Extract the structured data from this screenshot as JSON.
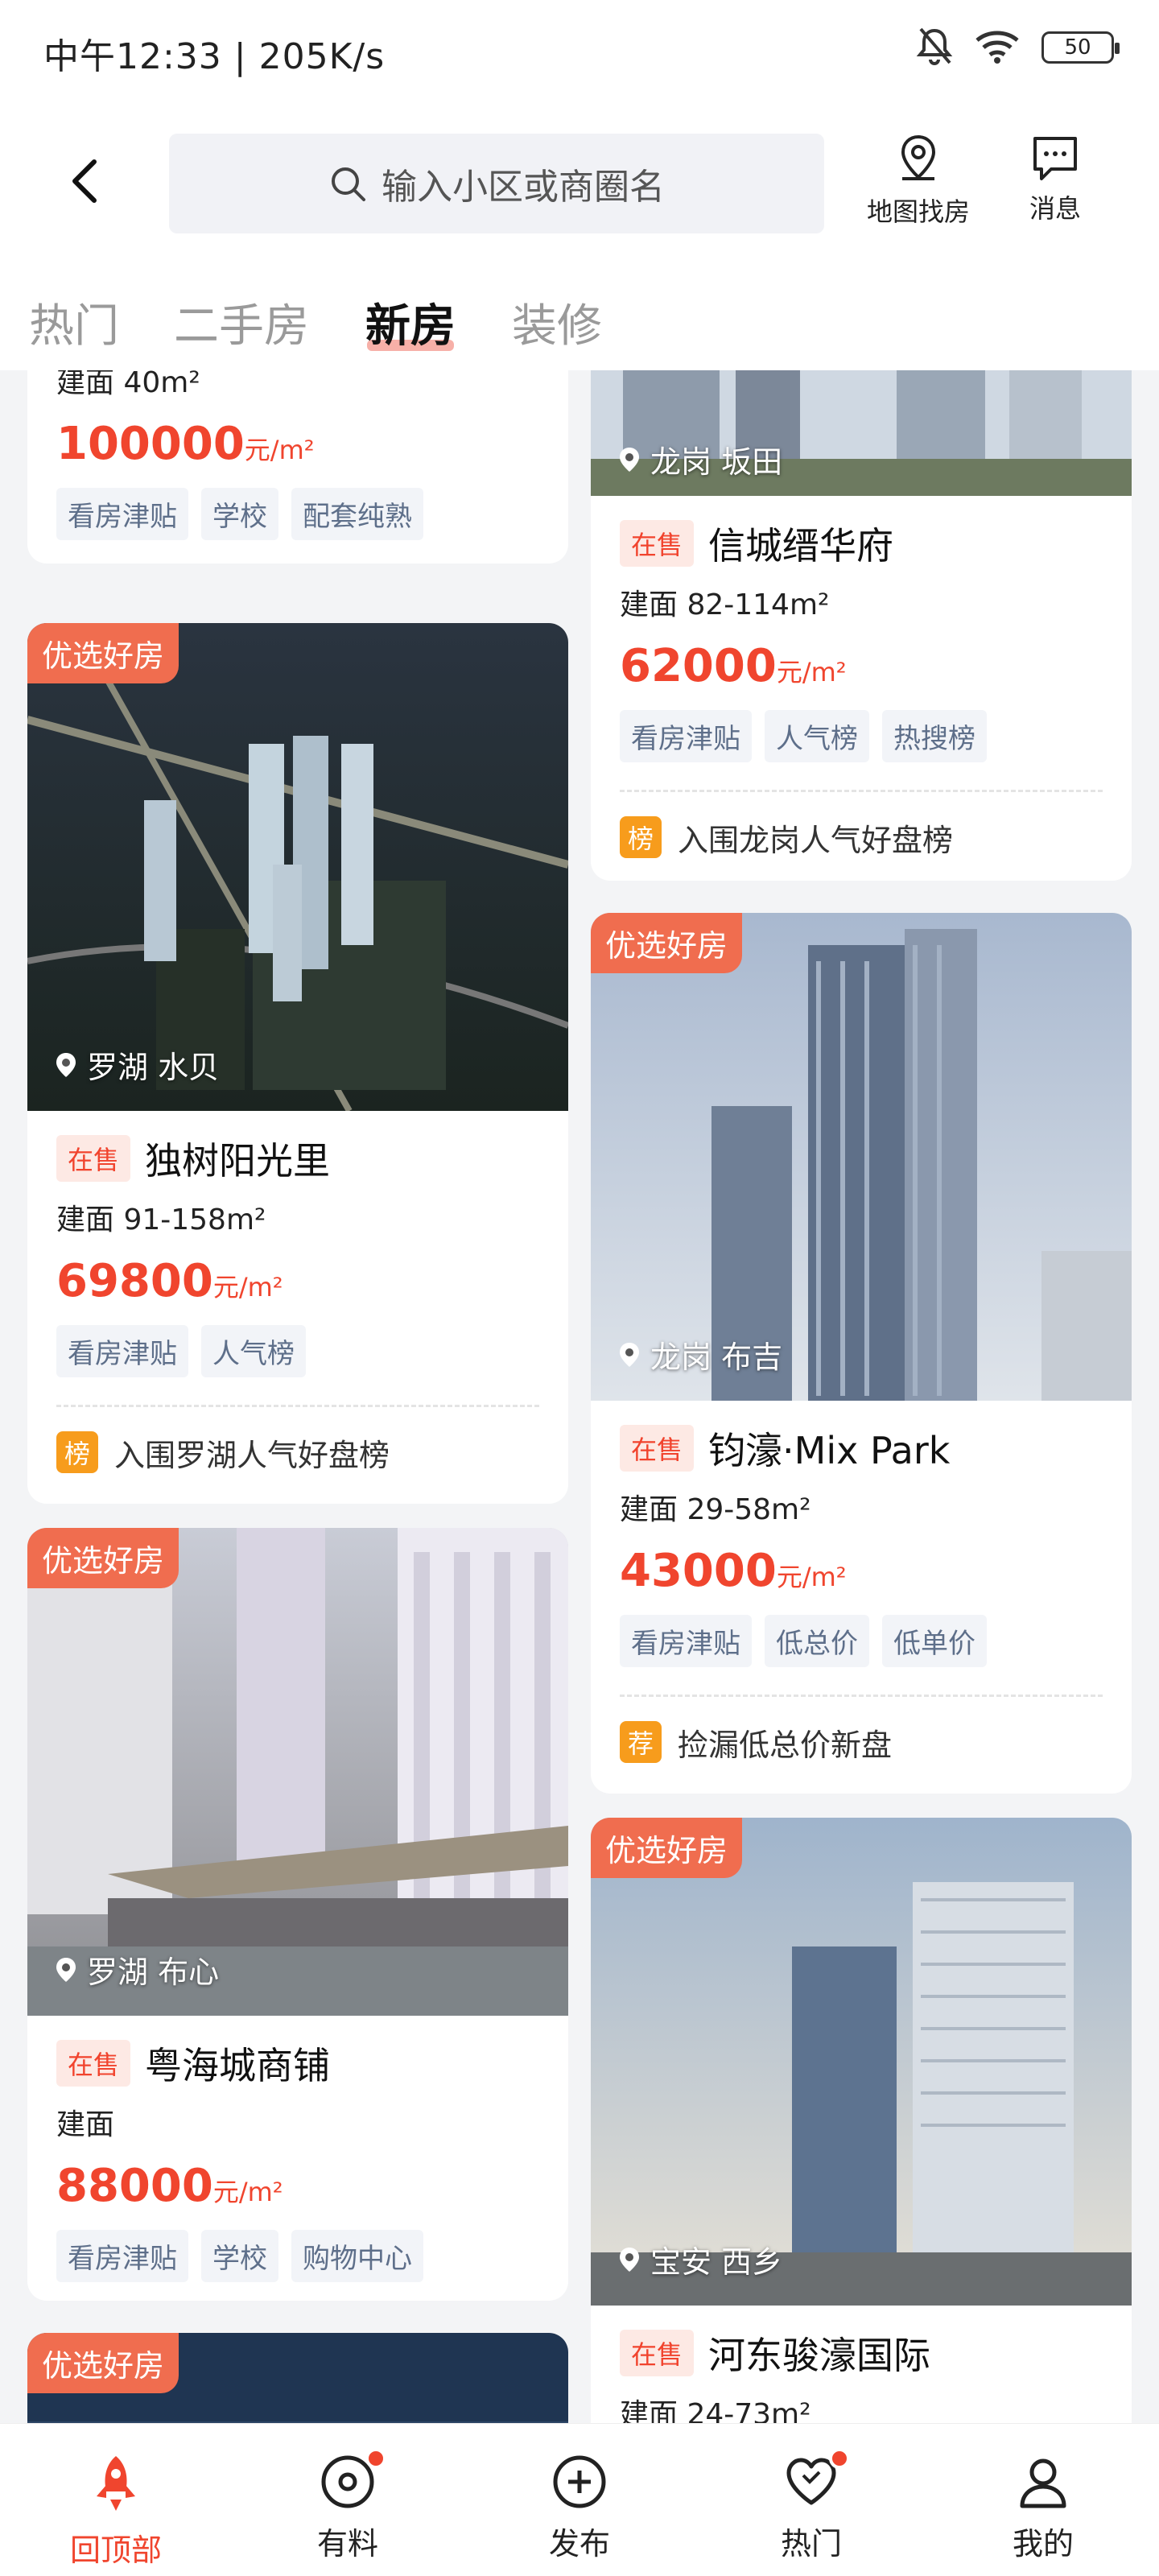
{
  "status_bar": {
    "time": "中午12:33 | 205K/s",
    "battery": "50"
  },
  "header": {
    "search_placeholder": "输入小区或商圈名",
    "map_label": "地图找房",
    "message_label": "消息"
  },
  "tabs": [
    "热门",
    "二手房",
    "新房",
    "装修"
  ],
  "active_tab": "新房",
  "left_column": [
    {
      "partial_top": true,
      "area": "建面 40m²",
      "price": "100000",
      "unit": "元/m²",
      "tags": [
        "看房津贴",
        "学校",
        "配套纯熟"
      ]
    },
    {
      "badge": "优选好房",
      "location": "罗湖 水贝",
      "status": "在售",
      "name": "独树阳光里",
      "area": "建面 91-158m²",
      "price": "69800",
      "unit": "元/m²",
      "tags": [
        "看房津贴",
        "人气榜"
      ],
      "rank_icon": "榜",
      "rank_text": "入围罗湖人气好盘榜"
    },
    {
      "badge": "优选好房",
      "location": "罗湖 布心",
      "status": "在售",
      "name": "粤海城商铺",
      "area": "建面",
      "price": "88000",
      "unit": "元/m²",
      "tags": [
        "看房津贴",
        "学校",
        "购物中心"
      ]
    },
    {
      "badge": "优选好房"
    }
  ],
  "right_column": [
    {
      "location": "龙岗 坂田",
      "status": "在售",
      "name": "信城缙华府",
      "area": "建面 82-114m²",
      "price": "62000",
      "unit": "元/m²",
      "tags": [
        "看房津贴",
        "人气榜",
        "热搜榜"
      ],
      "rank_icon": "榜",
      "rank_text": "入围龙岗人气好盘榜"
    },
    {
      "badge": "优选好房",
      "location": "龙岗 布吉",
      "status": "在售",
      "name": "钧濠·Mix Park",
      "area": "建面 29-58m²",
      "price": "43000",
      "unit": "元/m²",
      "tags": [
        "看房津贴",
        "低总价",
        "低单价"
      ],
      "rank_icon": "荐",
      "rank_text": "捡漏低总价新盘"
    },
    {
      "badge": "优选好房",
      "location": "宝安 西乡",
      "status": "在售",
      "name": "河东骏濠国际",
      "area": "建面 24-73m²"
    }
  ],
  "bottom_nav": [
    {
      "label": "回顶部",
      "active": true
    },
    {
      "label": "有料",
      "dot": true
    },
    {
      "label": "发布"
    },
    {
      "label": "热门",
      "dot": true
    },
    {
      "label": "我的"
    }
  ],
  "colors": {
    "accent": "#f0452e",
    "pick_badge": "#f06d4f",
    "rank_badge": "#f79c1c",
    "tag_bg": "#f2f4f8",
    "tag_text": "#5e6f8a"
  }
}
